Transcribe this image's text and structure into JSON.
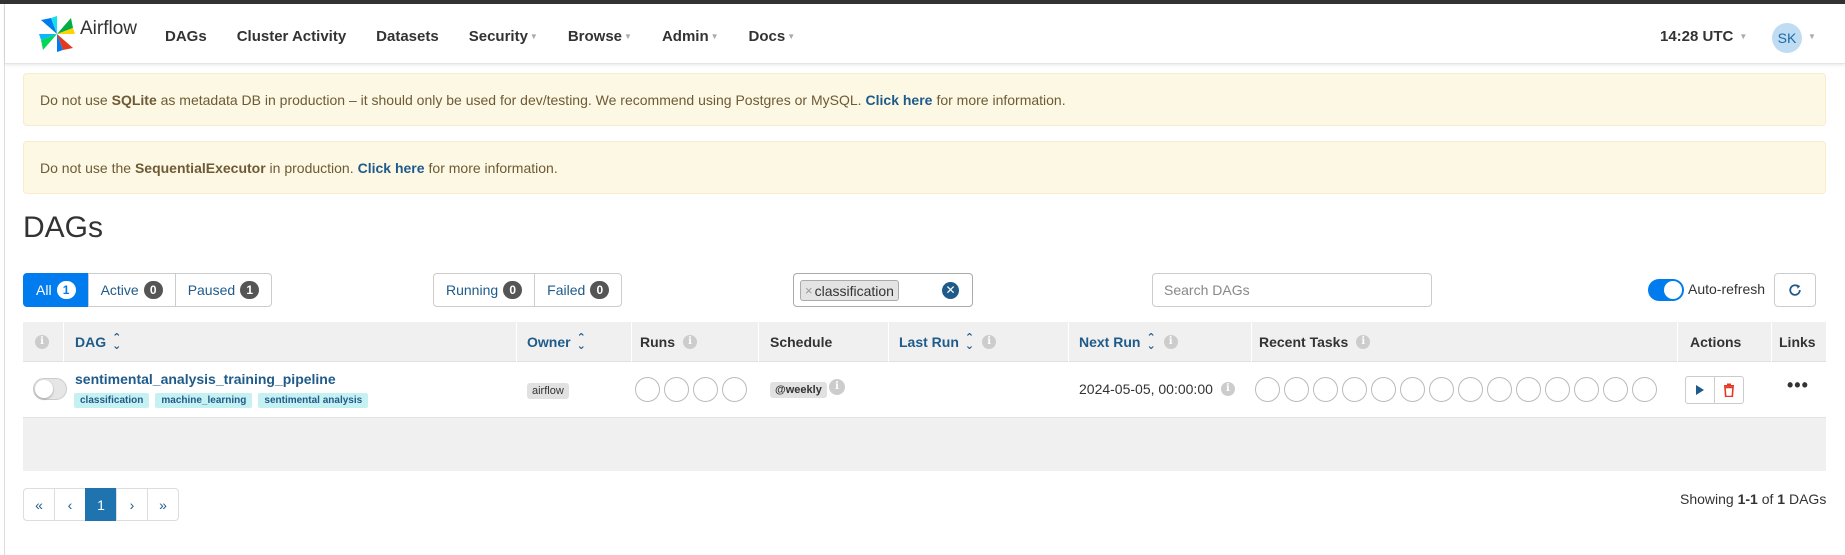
{
  "app": {
    "name": "Airflow"
  },
  "nav": {
    "items": [
      {
        "label": "DAGs",
        "dropdown": false
      },
      {
        "label": "Cluster Activity",
        "dropdown": false
      },
      {
        "label": "Datasets",
        "dropdown": false
      },
      {
        "label": "Security",
        "dropdown": true
      },
      {
        "label": "Browse",
        "dropdown": true
      },
      {
        "label": "Admin",
        "dropdown": true
      },
      {
        "label": "Docs",
        "dropdown": true
      }
    ],
    "clock": "14:28 UTC",
    "user_initials": "SK"
  },
  "alerts": {
    "sqlite": {
      "pre": "Do not use ",
      "bold": "SQLite",
      "mid": " as metadata DB in production – it should only be used for dev/testing. We recommend using Postgres or MySQL.",
      "link": "Click here",
      "post": "for more information."
    },
    "executor": {
      "pre": "Do not use the ",
      "bold": "SequentialExecutor",
      "mid": " in production.",
      "link": "Click here",
      "post": "for more information."
    }
  },
  "page": {
    "title": "DAGs"
  },
  "filters": {
    "status": [
      {
        "label": "All",
        "count": "1",
        "active": true
      },
      {
        "label": "Active",
        "count": "0",
        "active": false
      },
      {
        "label": "Paused",
        "count": "1",
        "active": false
      }
    ],
    "run_state": [
      {
        "label": "Running",
        "count": "0"
      },
      {
        "label": "Failed",
        "count": "0"
      }
    ],
    "tag_filter": {
      "remove": "×",
      "value": "classification",
      "clear": "✕"
    },
    "search_placeholder": "Search DAGs",
    "auto_refresh": {
      "label": "Auto-refresh",
      "enabled": true
    }
  },
  "table": {
    "headers": {
      "dag": "DAG",
      "owner": "Owner",
      "runs": "Runs",
      "schedule": "Schedule",
      "last_run": "Last Run",
      "next_run": "Next Run",
      "recent_tasks": "Recent Tasks",
      "actions": "Actions",
      "links": "Links"
    },
    "rows": [
      {
        "dag_id": "sentimental_analysis_training_pipeline",
        "paused": true,
        "tags": [
          "classification",
          "machine_learning",
          "sentimental analysis"
        ],
        "owner": "airflow",
        "runs_circles": 4,
        "schedule": "@weekly",
        "last_run": "",
        "next_run": "2024-05-05, 00:00:00",
        "recent_task_circles": 14,
        "links_label": "•••"
      }
    ]
  },
  "pagination": {
    "first": "«",
    "prev": "‹",
    "current": "1",
    "next": "›",
    "last": "»"
  },
  "footer": {
    "showing_pre": "Showing",
    "range": "1-1",
    "of": "of",
    "total": "1",
    "unit": "DAGs"
  },
  "colors": {
    "primary": "#017cee",
    "link": "#1f5b8a",
    "alert_bg": "#fcf8e3",
    "tag_bg": "#c6f1f2",
    "delete": "#e43921"
  }
}
